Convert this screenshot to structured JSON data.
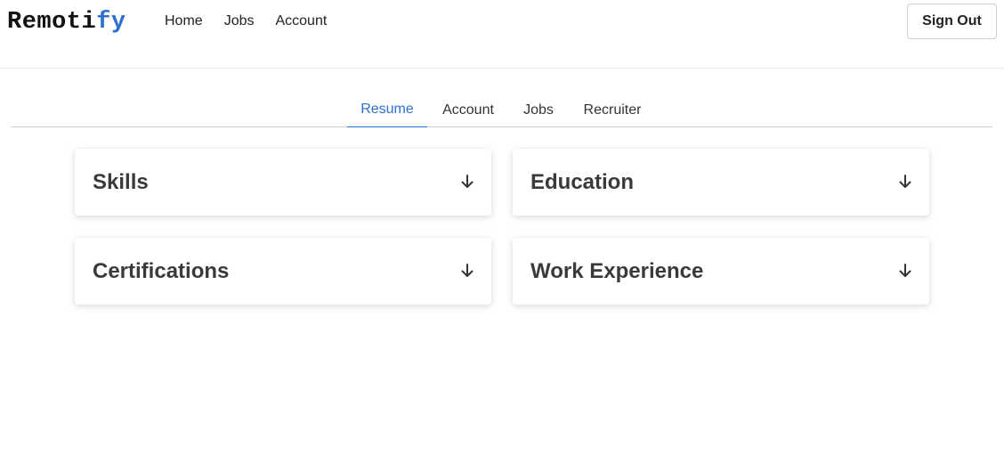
{
  "header": {
    "logo_main": "Remoti",
    "logo_accent": "fy",
    "nav": [
      "Home",
      "Jobs",
      "Account"
    ],
    "signout_label": "Sign Out",
    "accent_color": "#2f6fcf"
  },
  "tabs": {
    "items": [
      "Resume",
      "Account",
      "Jobs",
      "Recruiter"
    ],
    "active": "Resume"
  },
  "sections": [
    {
      "title": "Skills",
      "icon": "arrow-down-icon"
    },
    {
      "title": "Education",
      "icon": "arrow-down-icon"
    },
    {
      "title": "Certifications",
      "icon": "arrow-down-icon"
    },
    {
      "title": "Work Experience",
      "icon": "arrow-down-icon"
    }
  ]
}
